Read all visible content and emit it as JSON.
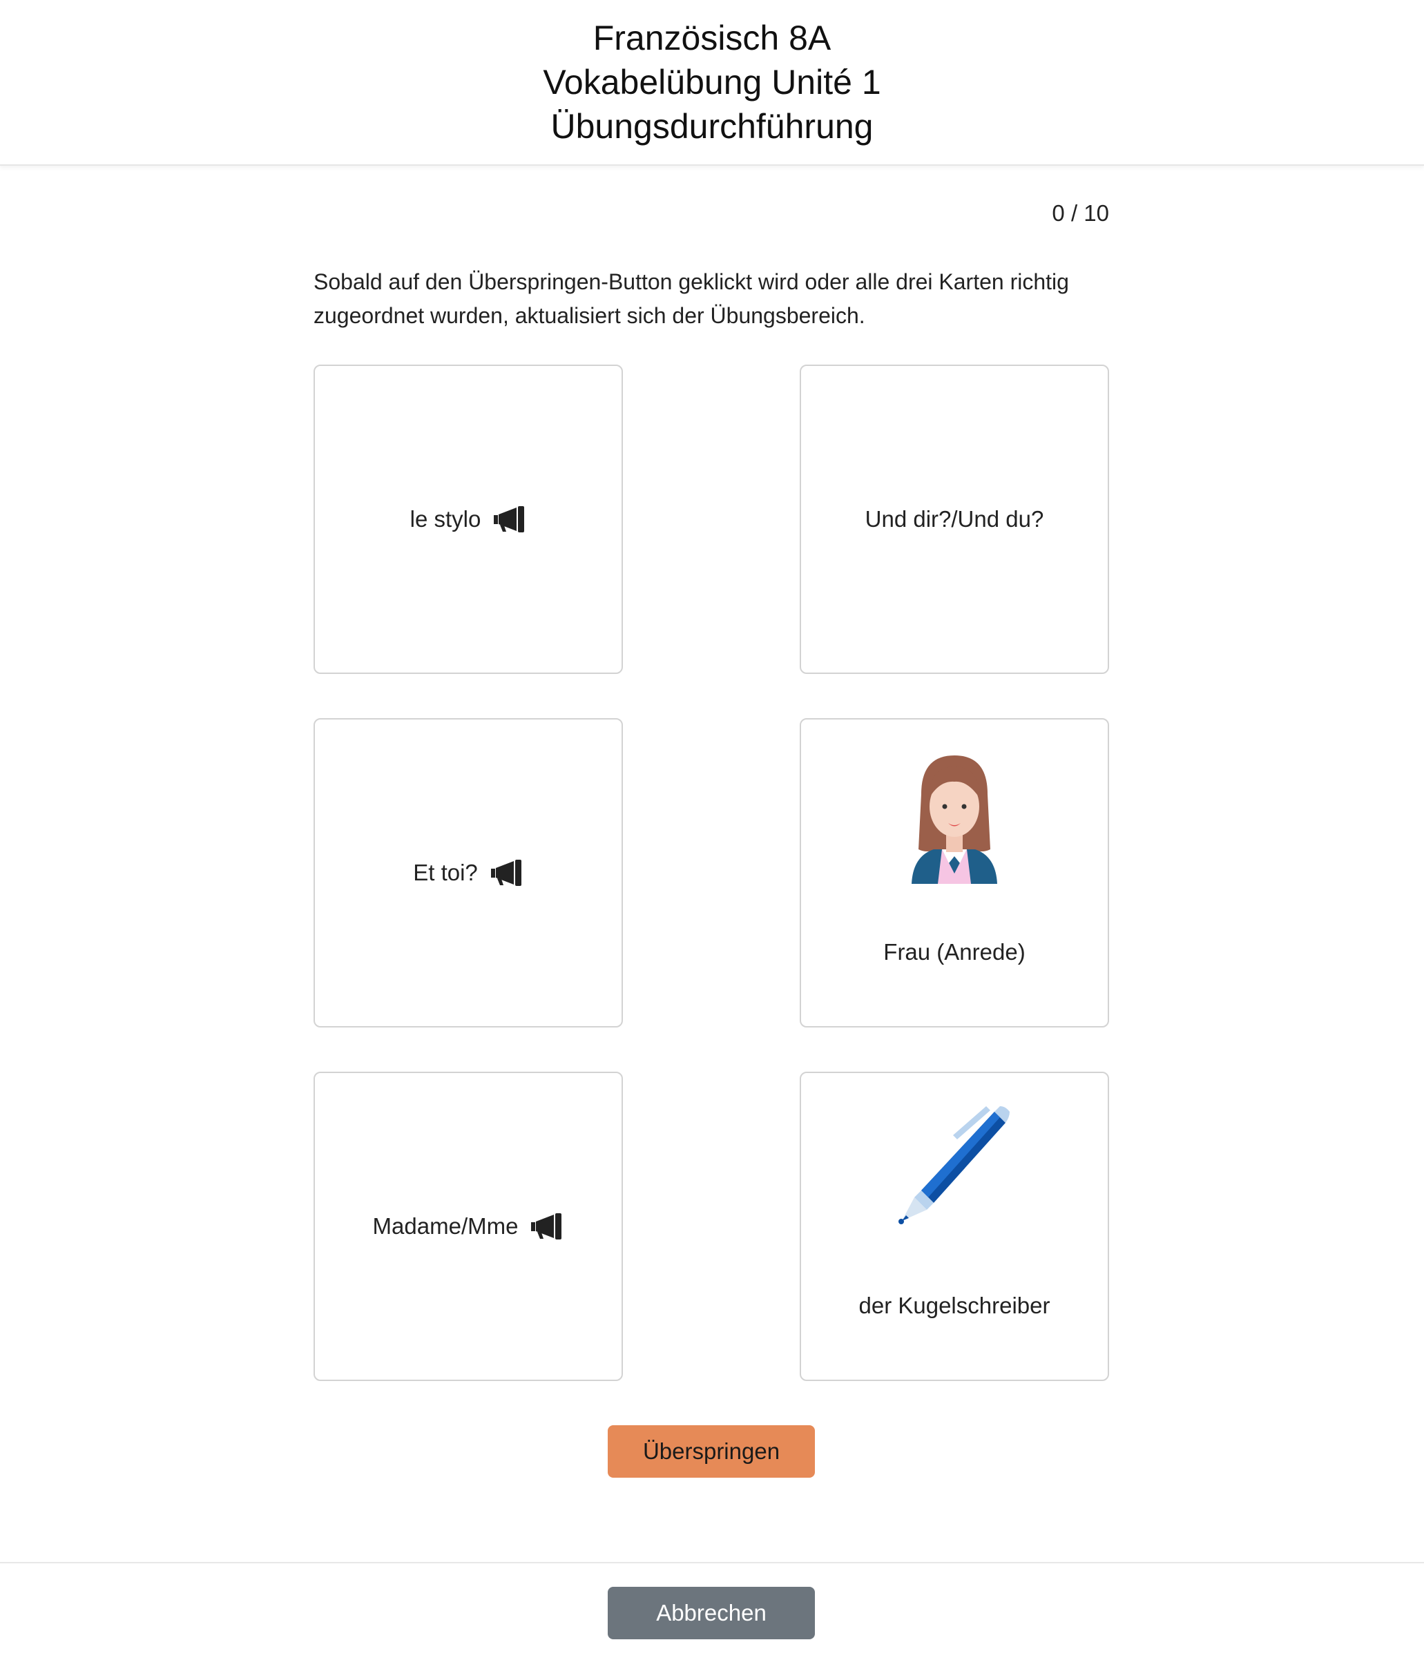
{
  "header": {
    "line1": "Französisch 8A",
    "line2": "Vokabelübung Unité 1",
    "line3": "Übungsdurchführung"
  },
  "progress": {
    "counter": "0 / 10"
  },
  "instructions": "Sobald auf den Überspringen-Button geklickt wird oder alle drei Karten richtig zugeordnet wurden, aktualisiert sich der Übungsbereich.",
  "cards": [
    {
      "label": "le stylo",
      "icon": "speaker-icon"
    },
    {
      "label": "Und dir?/Und du?"
    },
    {
      "label": "Et toi?",
      "icon": "speaker-icon"
    },
    {
      "label": "Frau (Anrede)",
      "image": "woman-icon"
    },
    {
      "label": "Madame/Mme",
      "icon": "speaker-icon"
    },
    {
      "label": "der Kugelschreiber",
      "image": "pen-icon"
    }
  ],
  "buttons": {
    "skip": "Überspringen",
    "cancel": "Abbrechen"
  },
  "colors": {
    "skip_button": "#e68a57",
    "cancel_button": "#6c757d",
    "card_border": "#d3d3d3"
  }
}
